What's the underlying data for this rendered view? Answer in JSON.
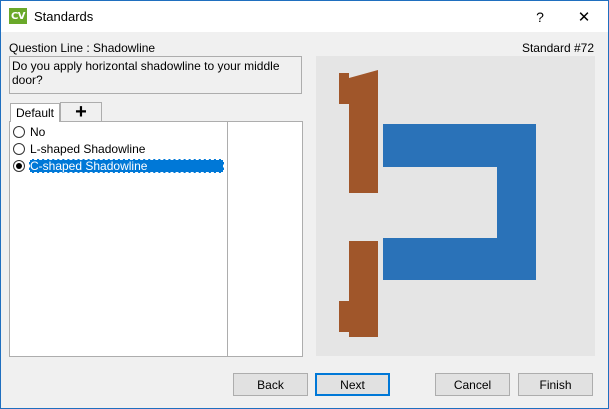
{
  "window": {
    "title": "Standards",
    "app_icon_text": "CV",
    "help_glyph": "?",
    "close_glyph": "✕"
  },
  "header": {
    "question_line": "Question Line : Shadowline",
    "standard_number": "Standard #72"
  },
  "question": {
    "text": "Do you apply horizontal shadowline to your middle door?"
  },
  "tabs": [
    {
      "label": "Default"
    },
    {
      "label": "+"
    }
  ],
  "options": [
    {
      "label": "No",
      "checked": false
    },
    {
      "label": "L-shaped Shadowline",
      "checked": false
    },
    {
      "label": "C-shaped Shadowline",
      "checked": true
    }
  ],
  "preview": {
    "icon": "c-shaped-shadowline-diagram",
    "colors": {
      "wood": "#a0562a",
      "channel": "#2a72b8",
      "background": "#e5e5e5"
    }
  },
  "buttons": {
    "back": "Back",
    "next": "Next",
    "cancel": "Cancel",
    "finish": "Finish"
  }
}
